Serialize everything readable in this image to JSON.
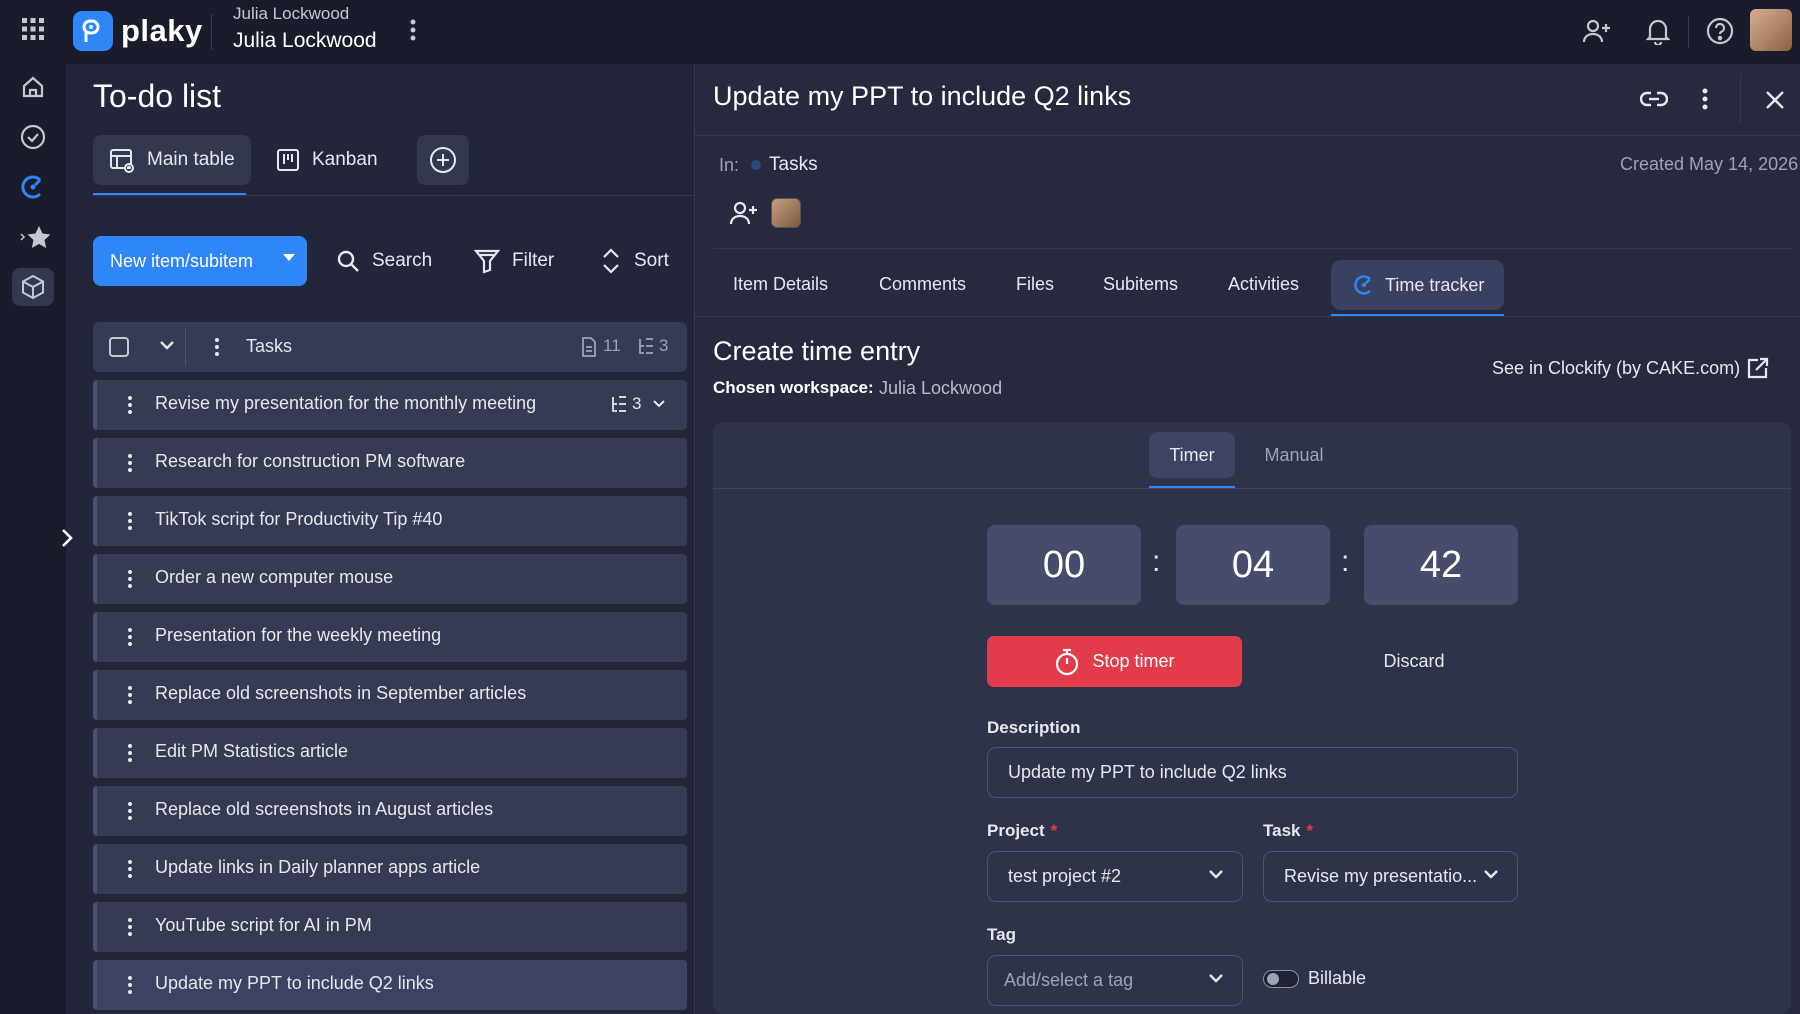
{
  "app": {
    "brand": "plaky"
  },
  "workspace": {
    "switcher_label": "Julia Lockwood",
    "name": "Julia Lockwood"
  },
  "board": {
    "title": "To-do list",
    "views": [
      {
        "label": "Main table",
        "icon": "table-icon",
        "active": true
      },
      {
        "label": "Kanban",
        "icon": "kanban-icon",
        "active": false
      }
    ]
  },
  "toolbar": {
    "new_item_label": "New item/subitem",
    "search_label": "Search",
    "filter_label": "Filter",
    "sort_label": "Sort"
  },
  "group": {
    "name": "Tasks",
    "item_count": "11",
    "subitem_count": "3"
  },
  "tasks": [
    {
      "name": "Revise my presentation for the monthly meeting",
      "subitems": "3"
    },
    {
      "name": "Research for construction PM software"
    },
    {
      "name": "TikTok script for Productivity Tip #40"
    },
    {
      "name": "Order a new computer mouse"
    },
    {
      "name": "Presentation for the weekly meeting"
    },
    {
      "name": "Replace old screenshots in September articles"
    },
    {
      "name": "Edit PM Statistics article"
    },
    {
      "name": "Replace old screenshots in August articles"
    },
    {
      "name": "Update links in Daily planner apps article"
    },
    {
      "name": "YouTube script for AI in PM"
    },
    {
      "name": "Update my PPT to include Q2 links",
      "selected": true
    }
  ],
  "detail": {
    "title": "Update my PPT to include Q2 links",
    "in_label": "In:",
    "in_board": "Tasks",
    "created": "Created May 14, 2026",
    "tabs": [
      "Item Details",
      "Comments",
      "Files",
      "Subitems",
      "Activities",
      "Time tracker"
    ],
    "active_tab": "Time tracker"
  },
  "time_entry": {
    "title": "Create time entry",
    "workspace_label": "Chosen workspace:",
    "workspace_value": "Julia Lockwood",
    "clockify_link": "See in Clockify (by CAKE.com)",
    "modes": {
      "timer": "Timer",
      "manual": "Manual"
    },
    "active_mode": "Timer",
    "timer": {
      "hours": "00",
      "minutes": "04",
      "seconds": "42",
      "separator": ":"
    },
    "stop_label": "Stop timer",
    "discard_label": "Discard",
    "description_label": "Description",
    "description_value": "Update my PPT to include Q2 links",
    "project_label": "Project",
    "project_value": "test project #2",
    "task_label": "Task",
    "task_value": "Revise my presentatio...",
    "required_mark": "*",
    "tag_label": "Tag",
    "tag_placeholder": "Add/select a tag",
    "billable_label": "Billable",
    "billable_on": false
  },
  "colors": {
    "accent": "#2f86f6",
    "danger": "#e23b4a",
    "background": "#1f2233",
    "panel": "#272a3e"
  }
}
